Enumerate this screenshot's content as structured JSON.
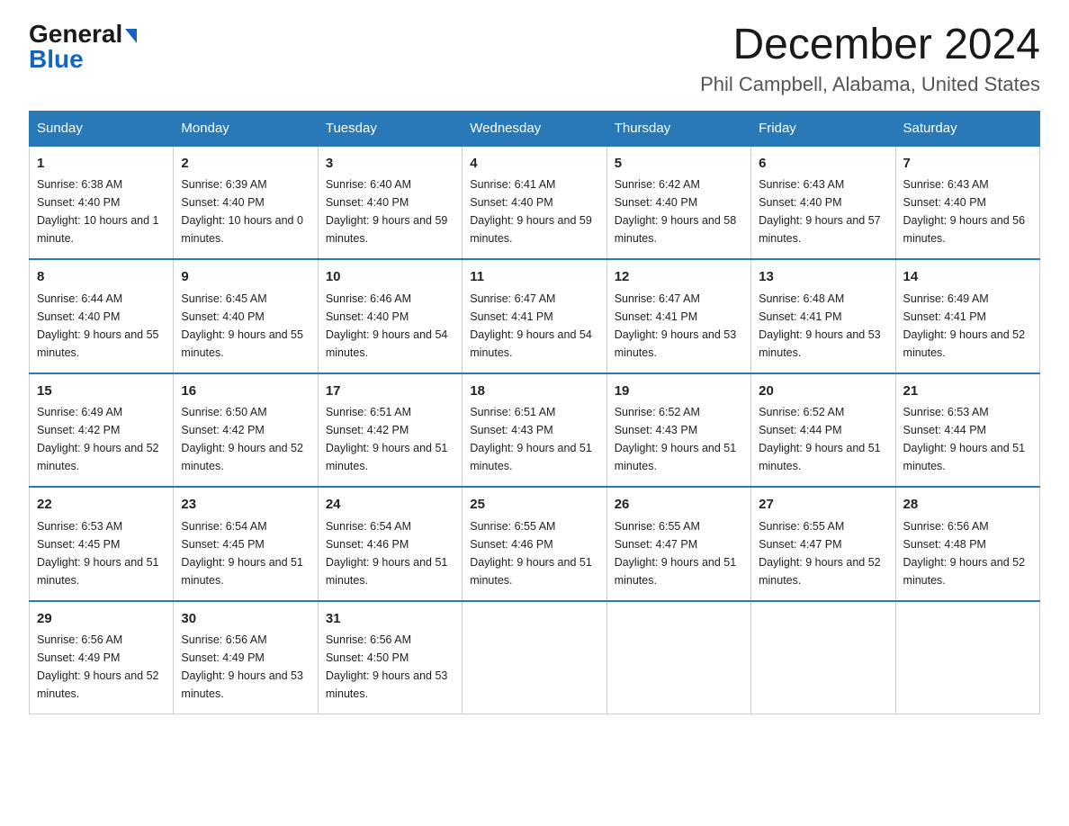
{
  "logo": {
    "general": "General",
    "blue": "Blue"
  },
  "title": "December 2024",
  "location": "Phil Campbell, Alabama, United States",
  "days_of_week": [
    "Sunday",
    "Monday",
    "Tuesday",
    "Wednesday",
    "Thursday",
    "Friday",
    "Saturday"
  ],
  "weeks": [
    [
      {
        "day": "1",
        "sunrise": "6:38 AM",
        "sunset": "4:40 PM",
        "daylight": "10 hours and 1 minute."
      },
      {
        "day": "2",
        "sunrise": "6:39 AM",
        "sunset": "4:40 PM",
        "daylight": "10 hours and 0 minutes."
      },
      {
        "day": "3",
        "sunrise": "6:40 AM",
        "sunset": "4:40 PM",
        "daylight": "9 hours and 59 minutes."
      },
      {
        "day": "4",
        "sunrise": "6:41 AM",
        "sunset": "4:40 PM",
        "daylight": "9 hours and 59 minutes."
      },
      {
        "day": "5",
        "sunrise": "6:42 AM",
        "sunset": "4:40 PM",
        "daylight": "9 hours and 58 minutes."
      },
      {
        "day": "6",
        "sunrise": "6:43 AM",
        "sunset": "4:40 PM",
        "daylight": "9 hours and 57 minutes."
      },
      {
        "day": "7",
        "sunrise": "6:43 AM",
        "sunset": "4:40 PM",
        "daylight": "9 hours and 56 minutes."
      }
    ],
    [
      {
        "day": "8",
        "sunrise": "6:44 AM",
        "sunset": "4:40 PM",
        "daylight": "9 hours and 55 minutes."
      },
      {
        "day": "9",
        "sunrise": "6:45 AM",
        "sunset": "4:40 PM",
        "daylight": "9 hours and 55 minutes."
      },
      {
        "day": "10",
        "sunrise": "6:46 AM",
        "sunset": "4:40 PM",
        "daylight": "9 hours and 54 minutes."
      },
      {
        "day": "11",
        "sunrise": "6:47 AM",
        "sunset": "4:41 PM",
        "daylight": "9 hours and 54 minutes."
      },
      {
        "day": "12",
        "sunrise": "6:47 AM",
        "sunset": "4:41 PM",
        "daylight": "9 hours and 53 minutes."
      },
      {
        "day": "13",
        "sunrise": "6:48 AM",
        "sunset": "4:41 PM",
        "daylight": "9 hours and 53 minutes."
      },
      {
        "day": "14",
        "sunrise": "6:49 AM",
        "sunset": "4:41 PM",
        "daylight": "9 hours and 52 minutes."
      }
    ],
    [
      {
        "day": "15",
        "sunrise": "6:49 AM",
        "sunset": "4:42 PM",
        "daylight": "9 hours and 52 minutes."
      },
      {
        "day": "16",
        "sunrise": "6:50 AM",
        "sunset": "4:42 PM",
        "daylight": "9 hours and 52 minutes."
      },
      {
        "day": "17",
        "sunrise": "6:51 AM",
        "sunset": "4:42 PM",
        "daylight": "9 hours and 51 minutes."
      },
      {
        "day": "18",
        "sunrise": "6:51 AM",
        "sunset": "4:43 PM",
        "daylight": "9 hours and 51 minutes."
      },
      {
        "day": "19",
        "sunrise": "6:52 AM",
        "sunset": "4:43 PM",
        "daylight": "9 hours and 51 minutes."
      },
      {
        "day": "20",
        "sunrise": "6:52 AM",
        "sunset": "4:44 PM",
        "daylight": "9 hours and 51 minutes."
      },
      {
        "day": "21",
        "sunrise": "6:53 AM",
        "sunset": "4:44 PM",
        "daylight": "9 hours and 51 minutes."
      }
    ],
    [
      {
        "day": "22",
        "sunrise": "6:53 AM",
        "sunset": "4:45 PM",
        "daylight": "9 hours and 51 minutes."
      },
      {
        "day": "23",
        "sunrise": "6:54 AM",
        "sunset": "4:45 PM",
        "daylight": "9 hours and 51 minutes."
      },
      {
        "day": "24",
        "sunrise": "6:54 AM",
        "sunset": "4:46 PM",
        "daylight": "9 hours and 51 minutes."
      },
      {
        "day": "25",
        "sunrise": "6:55 AM",
        "sunset": "4:46 PM",
        "daylight": "9 hours and 51 minutes."
      },
      {
        "day": "26",
        "sunrise": "6:55 AM",
        "sunset": "4:47 PM",
        "daylight": "9 hours and 51 minutes."
      },
      {
        "day": "27",
        "sunrise": "6:55 AM",
        "sunset": "4:47 PM",
        "daylight": "9 hours and 52 minutes."
      },
      {
        "day": "28",
        "sunrise": "6:56 AM",
        "sunset": "4:48 PM",
        "daylight": "9 hours and 52 minutes."
      }
    ],
    [
      {
        "day": "29",
        "sunrise": "6:56 AM",
        "sunset": "4:49 PM",
        "daylight": "9 hours and 52 minutes."
      },
      {
        "day": "30",
        "sunrise": "6:56 AM",
        "sunset": "4:49 PM",
        "daylight": "9 hours and 53 minutes."
      },
      {
        "day": "31",
        "sunrise": "6:56 AM",
        "sunset": "4:50 PM",
        "daylight": "9 hours and 53 minutes."
      },
      null,
      null,
      null,
      null
    ]
  ]
}
